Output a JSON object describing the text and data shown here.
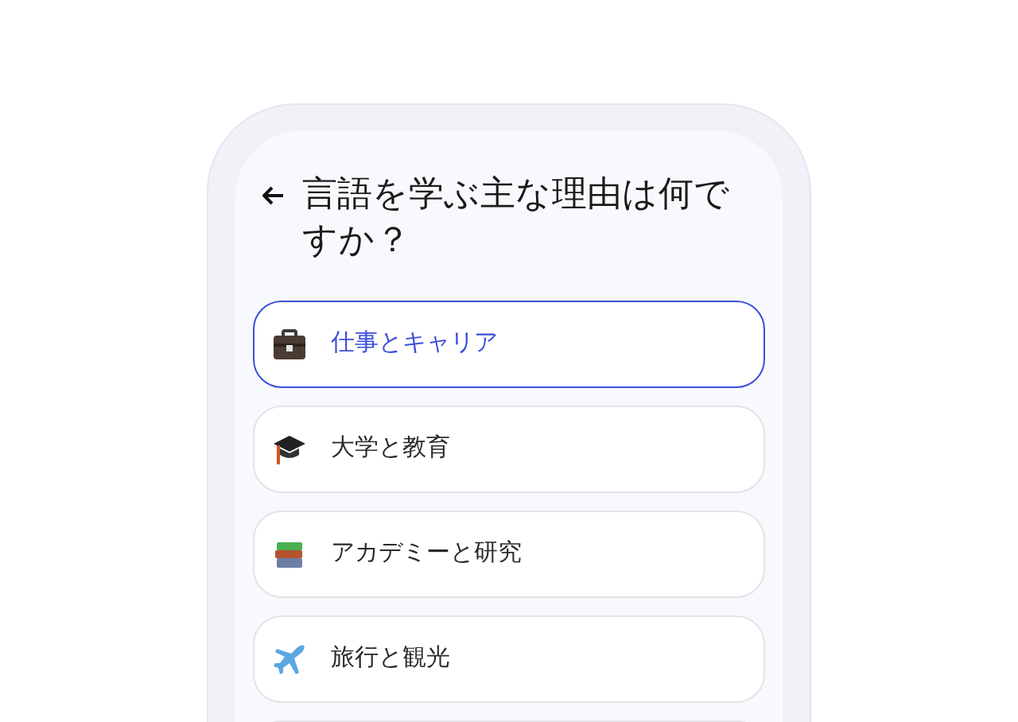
{
  "title": "言語を学ぶ主な理由は何ですか？",
  "options": [
    {
      "kind": "briefcase",
      "label": "仕事とキャリア",
      "selected": true
    },
    {
      "kind": "cap",
      "label": "大学と教育",
      "selected": false
    },
    {
      "kind": "books",
      "label": "アカデミーと研究",
      "selected": false
    },
    {
      "kind": "plane",
      "label": "旅行と観光",
      "selected": false
    }
  ]
}
